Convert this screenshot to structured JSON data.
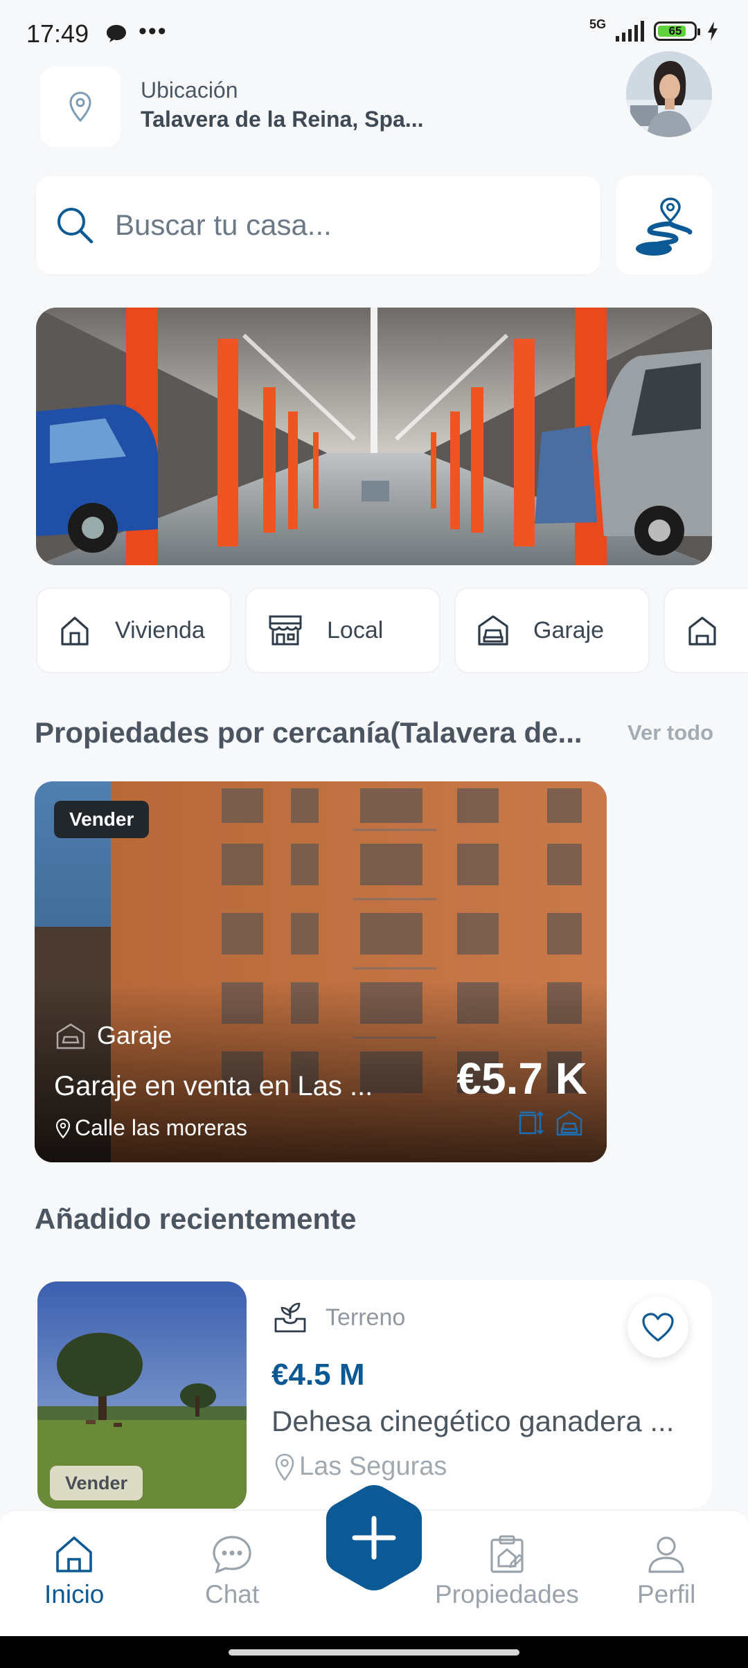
{
  "status_bar": {
    "time": "17:49",
    "dots": "•••",
    "network": "5G",
    "battery": "65"
  },
  "header": {
    "location_label": "Ubicación",
    "location_value": "Talavera de la Reina, Spa..."
  },
  "search": {
    "placeholder": "Buscar tu casa..."
  },
  "categories": [
    {
      "label": "Vivienda",
      "icon": "house-icon"
    },
    {
      "label": "Local",
      "icon": "storefront-icon"
    },
    {
      "label": "Garaje",
      "icon": "garage-car-icon"
    },
    {
      "label": "",
      "icon": "house-icon"
    }
  ],
  "nearby": {
    "title": "Propiedades por cercanía(Talavera de...",
    "see_all": "Ver todo",
    "card": {
      "badge": "Vender",
      "type": "Garaje",
      "name": "Garaje en venta en Las ...",
      "address": "Calle las moreras",
      "price": "€5.7 K"
    }
  },
  "recent": {
    "title": "Añadido recientemente",
    "card": {
      "badge": "Vender",
      "type": "Terreno",
      "price": "€4.5 M",
      "name": "Dehesa cinegético ganadera ...",
      "address": "Las Seguras"
    }
  },
  "nav": {
    "home": "Inicio",
    "chat": "Chat",
    "properties": "Propiedades",
    "profile": "Perfil"
  },
  "colors": {
    "accent": "#0b5a96",
    "background": "#f7f8fa",
    "muted": "#9aa3ab"
  }
}
